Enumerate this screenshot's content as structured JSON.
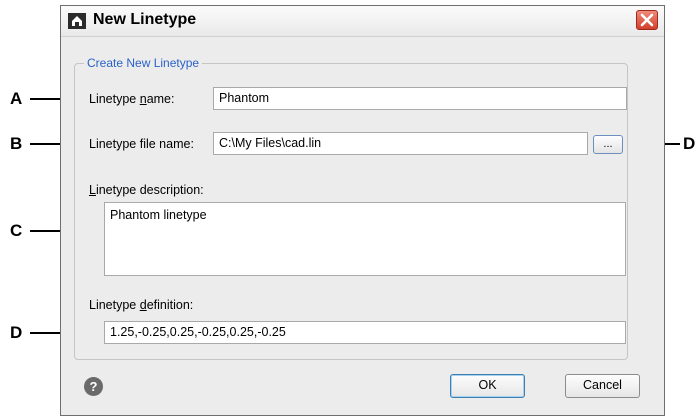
{
  "callouts": {
    "a": "A",
    "b": "B",
    "c": "C",
    "d_top": "D",
    "d_bottom": "D"
  },
  "dialog": {
    "title": "New Linetype",
    "group_label": "Create New Linetype",
    "name_label_pre": "Linetype ",
    "name_label_key": "n",
    "name_label_post": "ame:",
    "name_value": "Phantom",
    "file_label": "Linetype file name:",
    "file_value": "C:\\My Files\\cad.lin",
    "browse_label": "...",
    "desc_label_key": "L",
    "desc_label_post": "inetype description:",
    "desc_value": "Phantom linetype",
    "def_label_pre": "Linetype ",
    "def_label_key": "d",
    "def_label_post": "efinition:",
    "def_value": "1.25,-0.25,0.25,-0.25,0.25,-0.25",
    "ok_label": "OK",
    "cancel_label": "Cancel",
    "help_glyph": "?"
  },
  "icons": [
    "app-icon",
    "close-icon",
    "help-icon"
  ]
}
